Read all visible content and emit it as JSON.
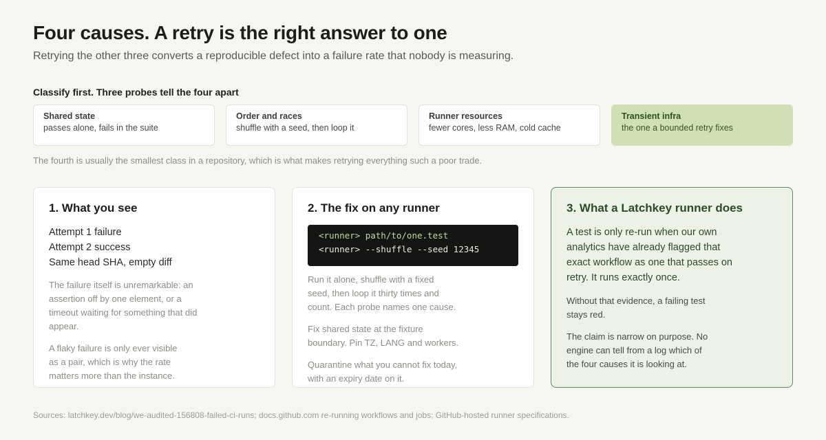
{
  "header": {
    "title": "Four causes. A retry is the right answer to one",
    "subtitle": "Retrying the other three converts a reproducible defect into a failure rate that nobody is measuring."
  },
  "classify": {
    "heading": "Classify first. Three probes tell the four apart",
    "probes": [
      {
        "name": "Shared state",
        "desc": "passes alone, fails in the suite"
      },
      {
        "name": "Order and races",
        "desc": "shuffle with a seed, then loop it"
      },
      {
        "name": "Runner resources",
        "desc": "fewer cores, less RAM, cold cache"
      },
      {
        "name": "Transient infra",
        "desc": "the one a bounded retry fixes"
      }
    ],
    "note": "The fourth is usually the smallest class in a repository, which is what makes retrying everything such a poor trade."
  },
  "cards": {
    "see": {
      "title": "1. What you see",
      "attempts": [
        "Attempt 1 failure",
        "Attempt 2 success",
        "Same head SHA, empty diff"
      ],
      "p1_lines": [
        "The failure itself is unremarkable: an",
        "assertion off by one element, or a",
        "timeout waiting for something that did",
        "appear."
      ],
      "p2_lines": [
        "A flaky failure is only ever visible",
        "as a pair, which is why the rate",
        "matters more than the instance."
      ]
    },
    "fix": {
      "title": "2. The fix on any runner",
      "code_lines": [
        "<runner> path/to/one.test",
        "<runner> --shuffle --seed 12345"
      ],
      "p1_lines": [
        "Run it alone, shuffle with a fixed",
        "seed, then loop it thirty times and",
        "count. Each probe names one cause."
      ],
      "p2_lines": [
        "Fix shared state at the fixture",
        "boundary. Pin TZ, LANG and workers."
      ],
      "p3_lines": [
        "Quarantine what you cannot fix today,",
        "with an expiry date on it."
      ]
    },
    "latchkey": {
      "title": "3. What a Latchkey runner does",
      "lead_lines": [
        "A test is only re-run when our own",
        "analytics have already flagged that",
        "exact workflow as one that passes on",
        "retry. It runs exactly once."
      ],
      "p1_lines": [
        "Without that evidence, a failing test",
        "stays red."
      ],
      "p2_lines": [
        "The claim is narrow on purpose. No",
        "engine can tell from a log which of",
        "the four causes it is looking at."
      ]
    }
  },
  "footer": {
    "sources": "Sources: latchkey.dev/blog/we-audited-156808-failed-ci-runs; docs.github.com re-running workflows and jobs; GitHub-hosted runner specifications."
  },
  "colors": {
    "background": "#f6f6f1",
    "highlight": "#cfe0b5",
    "accent_green": "#5a8a5c",
    "code_bg": "#141613"
  }
}
